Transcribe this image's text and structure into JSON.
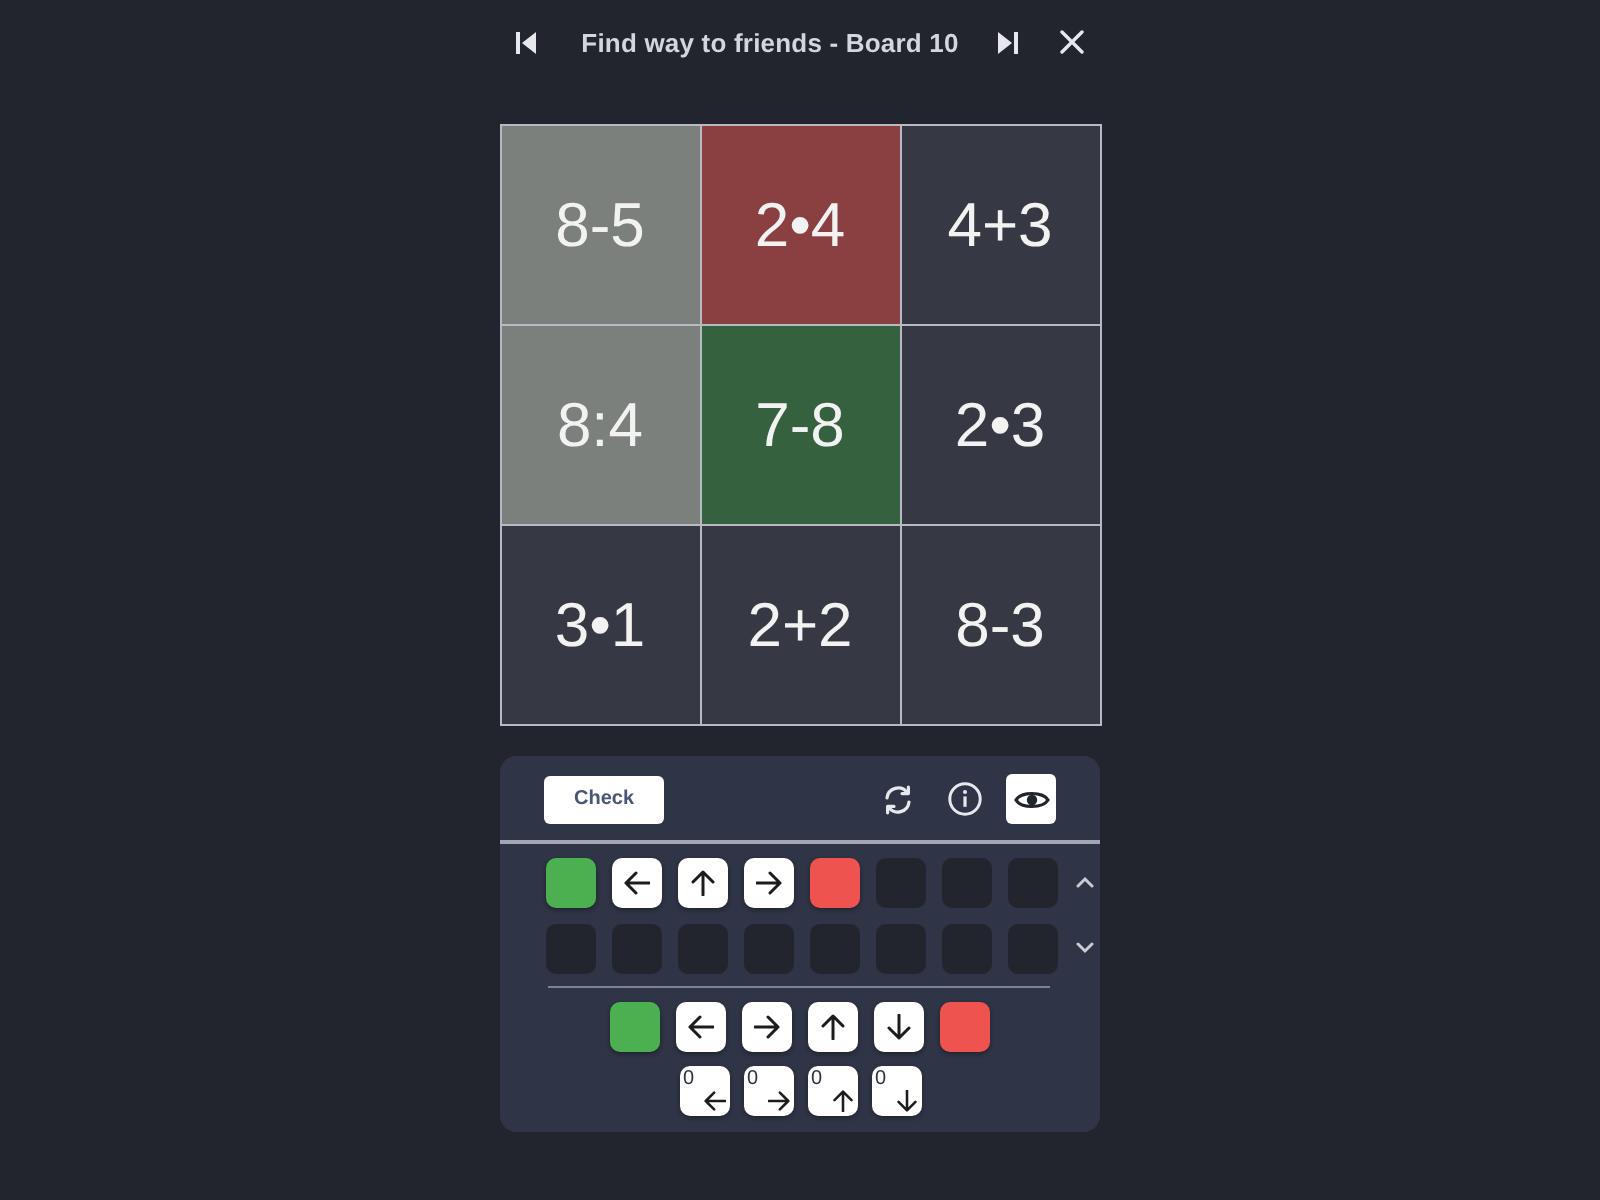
{
  "header": {
    "title": "Find way to friends - Board 10"
  },
  "board": {
    "cells": [
      {
        "text": "8-5",
        "kind": "path"
      },
      {
        "text": "2•4",
        "kind": "goal"
      },
      {
        "text": "4+3",
        "kind": "plain"
      },
      {
        "text": "8:4",
        "kind": "path"
      },
      {
        "text": "7-8",
        "kind": "start"
      },
      {
        "text": "2•3",
        "kind": "plain"
      },
      {
        "text": "3•1",
        "kind": "plain"
      },
      {
        "text": "2+2",
        "kind": "plain"
      },
      {
        "text": "8-3",
        "kind": "plain"
      }
    ]
  },
  "toolbar": {
    "check_button": "Check",
    "eye_toggle": {
      "on": true
    }
  },
  "program": {
    "slots": [
      {
        "kind": "start"
      },
      {
        "kind": "left"
      },
      {
        "kind": "up"
      },
      {
        "kind": "right"
      },
      {
        "kind": "end"
      },
      {
        "kind": "empty"
      },
      {
        "kind": "empty"
      },
      {
        "kind": "empty"
      },
      {
        "kind": "empty"
      },
      {
        "kind": "empty"
      },
      {
        "kind": "empty"
      },
      {
        "kind": "empty"
      },
      {
        "kind": "empty"
      },
      {
        "kind": "empty"
      },
      {
        "kind": "empty"
      },
      {
        "kind": "empty"
      }
    ]
  },
  "palette": {
    "blocks": [
      {
        "kind": "start"
      },
      {
        "kind": "left"
      },
      {
        "kind": "right"
      },
      {
        "kind": "up"
      },
      {
        "kind": "down"
      },
      {
        "kind": "end"
      }
    ],
    "counted_blocks": [
      {
        "count": "0",
        "kind": "left"
      },
      {
        "count": "0",
        "kind": "right"
      },
      {
        "count": "0",
        "kind": "up"
      },
      {
        "count": "0",
        "kind": "down"
      }
    ]
  }
}
